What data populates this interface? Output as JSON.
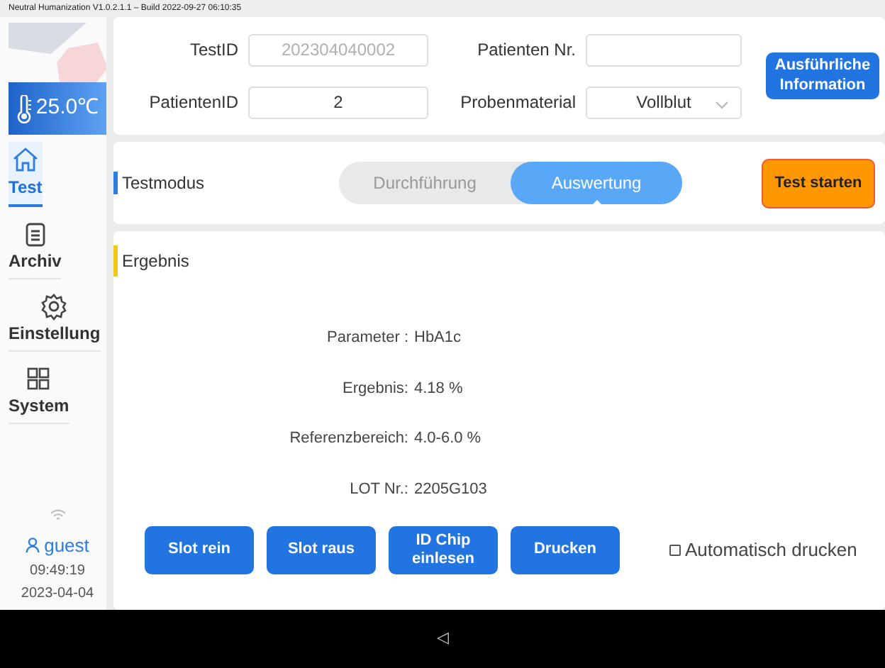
{
  "app_title": "Neutral Humanization V1.0.2.1.1  – Build 2022-09-27 06:10:35",
  "temperature": "25.0℃",
  "nav": [
    {
      "label": "Test",
      "kind": "home",
      "selected": true
    },
    {
      "label": "Archiv",
      "kind": "clipboard",
      "selected": false
    },
    {
      "label": "Einstellung",
      "kind": "gear",
      "selected": false
    },
    {
      "label": "System",
      "kind": "grid",
      "selected": false
    }
  ],
  "user": "guest",
  "time": "09:49:19",
  "date": "2023-04-04",
  "form": {
    "fields": [
      {
        "label": "TestID",
        "kind": "text",
        "placeholder": "202304040002"
      },
      {
        "label": "Patienten Nr.",
        "kind": "text"
      },
      {
        "label": "PatientenID",
        "kind": "text",
        "value": "2"
      },
      {
        "label": "Probenmaterial",
        "kind": "select",
        "value": "Vollblut"
      }
    ],
    "detail_button": "Ausführliche Information"
  },
  "mode": {
    "label": "Testmodus",
    "options": [
      {
        "label": "Durchführung",
        "selected": false
      },
      {
        "label": "Auswertung",
        "selected": true
      }
    ],
    "start_button": "Test starten"
  },
  "result": {
    "title": "Ergebnis",
    "rows": [
      {
        "label": "Parameter :",
        "value": "HbA1c"
      },
      {
        "label": "Ergebnis:",
        "value": "4.18 %"
      },
      {
        "label": "Referenzbereich:",
        "value": "4.0-6.0 %"
      },
      {
        "label": "LOT Nr.:",
        "value": "2205G103"
      }
    ]
  },
  "actions": [
    "Slot rein",
    "Slot raus",
    "ID Chip einlesen",
    "Drucken"
  ],
  "auto_print": {
    "label": "Automatisch drucken",
    "checked": false
  },
  "nav_bar": {
    "back": "◁"
  }
}
